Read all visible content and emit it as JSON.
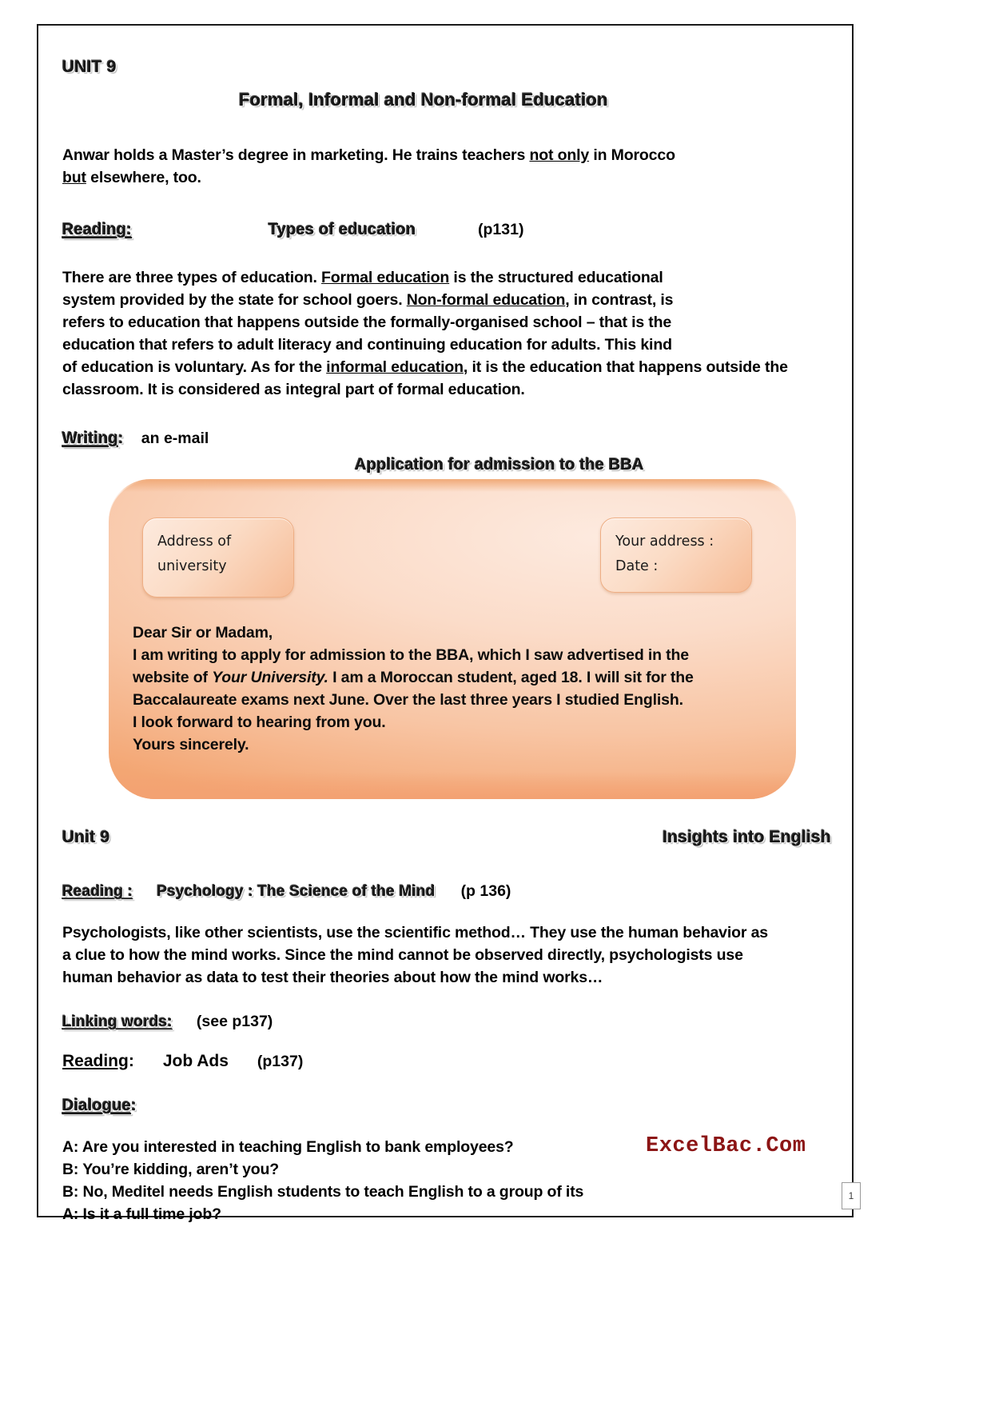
{
  "document": {
    "unit_label": "UNIT 9",
    "main_title": "Formal, Informal and Non-formal Education",
    "intro_line1_a": "Anwar holds a Master’s degree in marketing. He trains teachers ",
    "intro_line1_underline": "not only",
    "intro_line1_b": " in Morocco",
    "intro_line2_underline": "but",
    "intro_line2_b": " elsewhere, too."
  },
  "reading_types": {
    "label": "Reading:",
    "title": "Types of education",
    "page": "(p131)",
    "paragraph": {
      "s1": "There are three types of education. ",
      "u1": "Formal education",
      "s2": " is the structured educational",
      "s3": "system provided by the state for school goers. ",
      "u2": "Non-formal education",
      "s4": ", in contrast, is",
      "s5": "refers to education that happens outside the formally-organised school – that is the",
      "s6": "education that refers to adult literacy and continuing education for adults. This kind",
      "s7": "of education is voluntary. As for the ",
      "u3": "informal education",
      "s8": ", it is the education that happens outside the",
      "s9": "classroom. It is considered as integral part of formal education."
    }
  },
  "writing": {
    "label": "Writing",
    "colon": ":",
    "value": "an e-mail",
    "app_title": "Application for admission to the BBA",
    "address_left": [
      "Address of",
      "university"
    ],
    "address_right": [
      "Your  address :",
      "Date :"
    ],
    "letter": [
      "Dear Sir or Madam,",
      "I am writing to apply for admission to the BBA, which I saw advertised in the",
      "Baccalaureate exams next June. Over the last three years I studied English.",
      "I look forward to hearing from you.",
      "Yours sincerely."
    ],
    "letter_line3_a": "website of ",
    "letter_line3_italic": "Your University.",
    "letter_line3_b": " I am a Moroccan student, aged 18. I will sit for the"
  },
  "footer_header": {
    "unit": "Unit 9",
    "book": "Insights into English"
  },
  "reading_psychology": {
    "label": "Reading :",
    "title": "Psychology : The Science of the Mind",
    "page": "(p 136)",
    "paragraph": [
      "Psychologists, like other scientists, use the scientific method… They use the human behavior as",
      "a clue to how the mind works. Since the mind cannot be observed directly, psychologists use",
      "human behavior as data to test their theories about how the mind works…"
    ]
  },
  "linking_words": {
    "label": "Linking words:",
    "page": "(see p137)"
  },
  "reading_job_ads": {
    "label": "Reading",
    "colon": ":",
    "title": "Job Ads",
    "page": "(p137)"
  },
  "dialogue": {
    "label": "Dialogue",
    "colon": ":",
    "lines": [
      "A: Are you interested in teaching English to bank employees?",
      "B: You’re kidding, aren’t you?",
      "B: No, Meditel needs English students to teach English to a group of its",
      "A: Is it a full time job?"
    ]
  },
  "watermark": "ExcelBac.Com",
  "page_number": "1",
  "colors": {
    "accent_orange": "#f3a673",
    "box_light": "#fdeadf",
    "watermark_red": "#8c1515",
    "text": "#000000"
  }
}
